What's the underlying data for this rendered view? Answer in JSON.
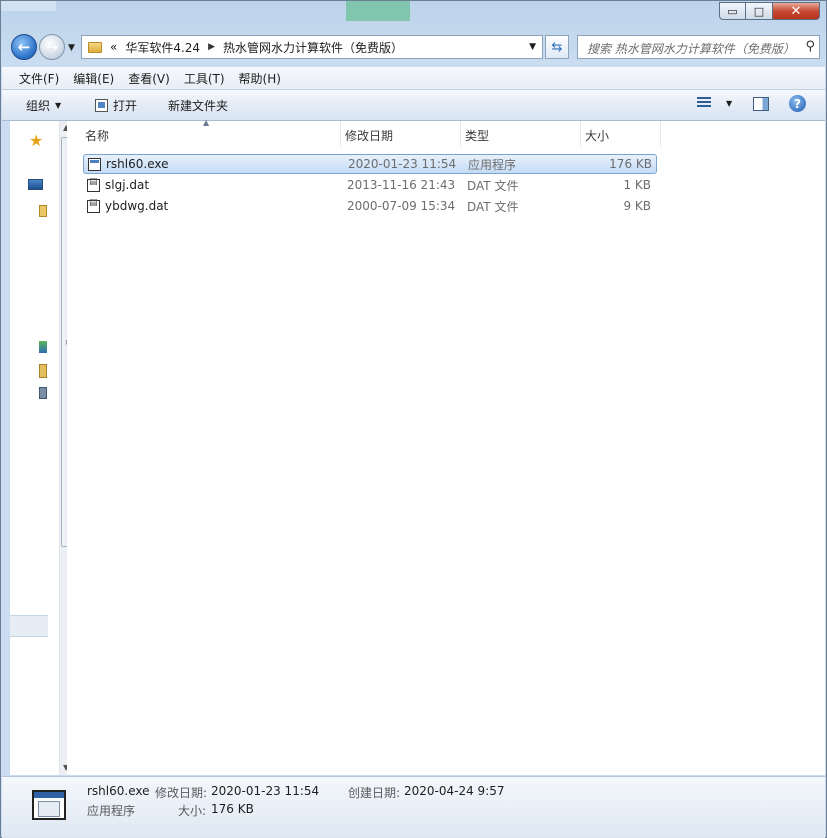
{
  "window": {
    "controls": {
      "minimize": "▭",
      "maximize": "□",
      "close": "✕"
    }
  },
  "address": {
    "history_prefix": "«",
    "crumbs": [
      "华军软件4.24",
      "热水管网水力计算软件（免费版）"
    ],
    "search_placeholder": "搜索 热水管网水力计算软件（免费版）"
  },
  "menu": [
    "文件(F)",
    "编辑(E)",
    "查看(V)",
    "工具(T)",
    "帮助(H)"
  ],
  "toolbar": {
    "organize": "组织",
    "open": "打开",
    "new_folder": "新建文件夹",
    "help": "?"
  },
  "columns": {
    "name": "名称",
    "date": "修改日期",
    "type": "类型",
    "size": "大小"
  },
  "files": [
    {
      "name": "rshl60.exe",
      "date": "2020-01-23 11:54",
      "type": "应用程序",
      "size": "176 KB",
      "selected": true,
      "icon": "exe-icon"
    },
    {
      "name": "slgj.dat",
      "date": "2013-11-16 21:43",
      "type": "DAT 文件",
      "size": "1 KB",
      "selected": false,
      "icon": "dat-icon"
    },
    {
      "name": "ybdwg.dat",
      "date": "2000-07-09 15:34",
      "type": "DAT 文件",
      "size": "9 KB",
      "selected": false,
      "icon": "dat-icon"
    }
  ],
  "details": {
    "filename": "rshl60.exe",
    "modified_label": "修改日期:",
    "modified_value": "2020-01-23 11:54",
    "created_label": "创建日期:",
    "created_value": "2020-04-24 9:57",
    "type": "应用程序",
    "size_label": "大小:",
    "size_value": "176 KB"
  }
}
